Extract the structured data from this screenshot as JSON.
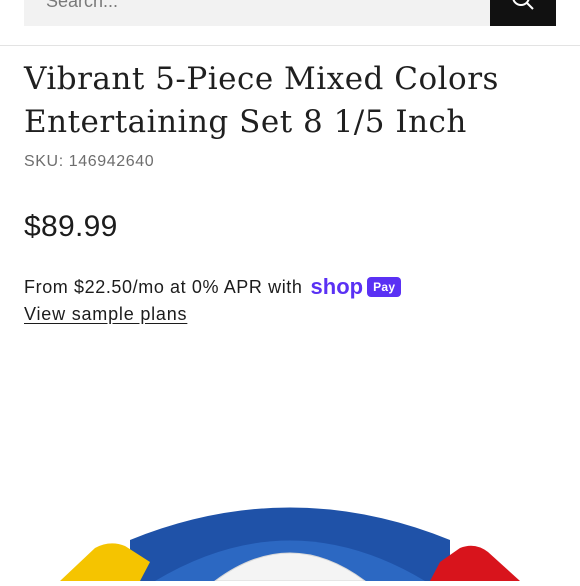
{
  "search": {
    "placeholder": "Search..."
  },
  "product": {
    "title": "Vibrant 5-Piece Mixed Colors Entertaining Set 8 1/5 Inch",
    "sku": "SKU: 146942640",
    "price": "$89.99"
  },
  "financing": {
    "text": "From $22.50/mo at 0% APR with",
    "brand_word": "shop",
    "brand_badge": "Pay",
    "brand_color": "#5a31f4",
    "link_label": "View sample plans"
  },
  "image": {
    "colors": {
      "blue": "#1f52a8",
      "yellow": "#f5c400",
      "red": "#d8141c",
      "white": "#f4f4f4"
    }
  }
}
